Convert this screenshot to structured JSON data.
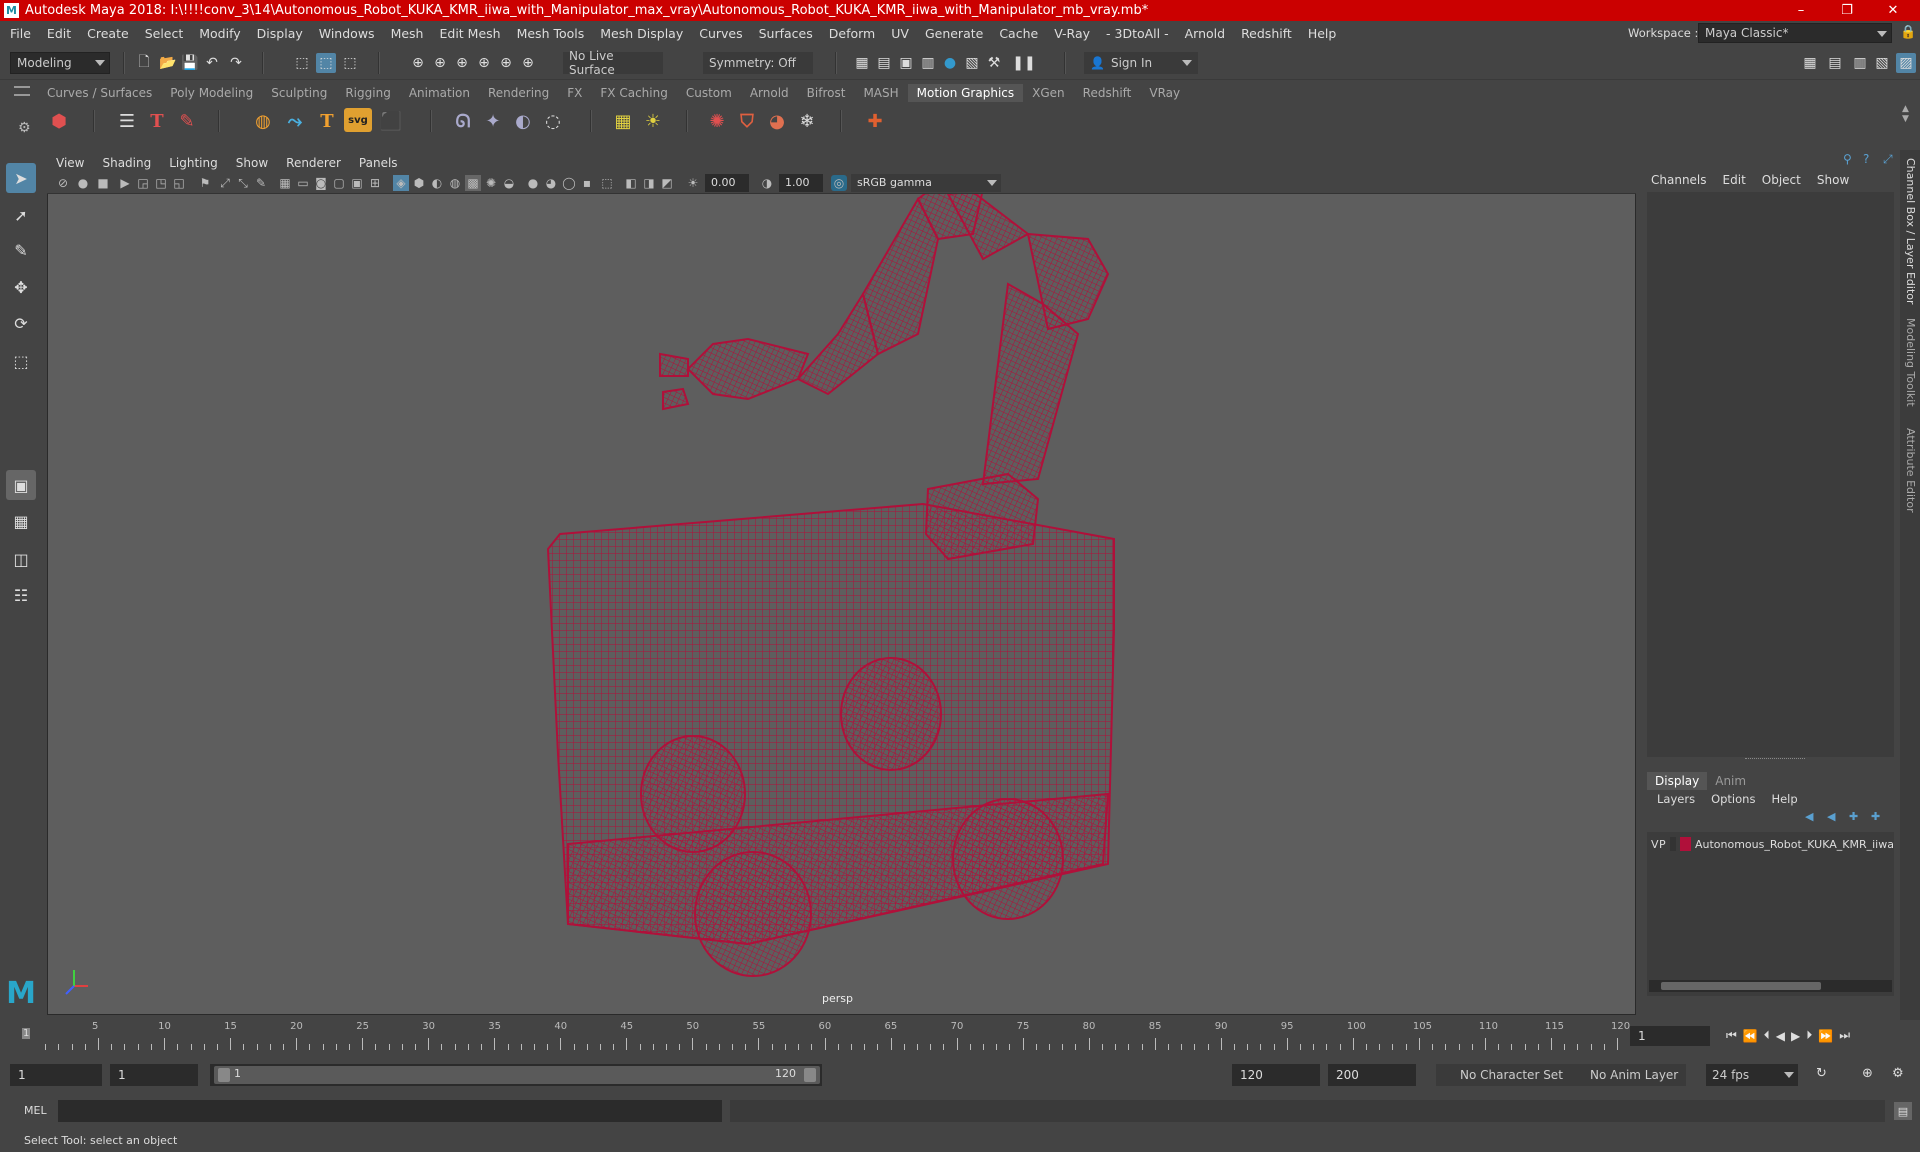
{
  "window": {
    "title": "Autodesk Maya 2018: I:\\!!!!conv_3\\14\\Autonomous_Robot_KUKA_KMR_iiwa_with_Manipulator_max_vray\\Autonomous_Robot_KUKA_KMR_iiwa_with_Manipulator_mb_vray.mb*",
    "logo": "M",
    "minimize": "–",
    "restore": "❐",
    "close": "✕"
  },
  "menubar": {
    "items": [
      "File",
      "Edit",
      "Create",
      "Select",
      "Modify",
      "Display",
      "Windows",
      "Mesh",
      "Edit Mesh",
      "Mesh Tools",
      "Mesh Display",
      "Curves",
      "Surfaces",
      "Deform",
      "UV",
      "Generate",
      "Cache",
      "V-Ray",
      "- 3DtoAll -",
      "Arnold",
      "Redshift",
      "Help"
    ],
    "workspace_label": "Workspace :",
    "workspace_value": "Maya Classic*"
  },
  "toolbar": {
    "mode": "Modeling",
    "live_surface": "No Live Surface",
    "symmetry": "Symmetry: Off",
    "sign_in": "Sign In"
  },
  "shelf": {
    "tabs": [
      "Curves / Surfaces",
      "Poly Modeling",
      "Sculpting",
      "Rigging",
      "Animation",
      "Rendering",
      "FX",
      "FX Caching",
      "Custom",
      "Arnold",
      "Bifrost",
      "MASH",
      "Motion Graphics",
      "XGen",
      "Redshift",
      "VRay"
    ],
    "active_tab": "Motion Graphics",
    "svg_label": "svg"
  },
  "viewport": {
    "menu": [
      "View",
      "Shading",
      "Lighting",
      "Show",
      "Renderer",
      "Panels"
    ],
    "exposure": "0.00",
    "gamma": "1.00",
    "color_space": "sRGB gamma",
    "camera": "persp",
    "wire_color": "#b0103a",
    "bg_color": "#5e5e5e"
  },
  "channel_box": {
    "menu": [
      "Channels",
      "Edit",
      "Object",
      "Show"
    ],
    "side_tabs": [
      "Channel Box / Layer Editor",
      "Modeling Toolkit",
      "Attribute Editor"
    ]
  },
  "layer_editor": {
    "tabs": [
      "Display",
      "Anim"
    ],
    "active_tab": "Display",
    "menu": [
      "Layers",
      "Options",
      "Help"
    ],
    "layers": [
      {
        "v": "V",
        "p": "P",
        "color": "#b0103a",
        "name": "Autonomous_Robot_KUKA_KMR_iiwa"
      }
    ]
  },
  "timeline": {
    "ticks": [
      "5",
      "10",
      "15",
      "20",
      "25",
      "30",
      "35",
      "40",
      "45",
      "50",
      "55",
      "60",
      "65",
      "70",
      "75",
      "80",
      "85",
      "90",
      "95",
      "100",
      "105",
      "110",
      "115",
      "120"
    ],
    "current_frame_marker": "1",
    "current_frame": "1"
  },
  "range": {
    "start": "1",
    "playback_start": "1",
    "slider_start": "1",
    "slider_end": "120",
    "playback_end": "120",
    "end": "200",
    "character_set": "No Character Set",
    "anim_layer": "No Anim Layer",
    "fps": "24 fps"
  },
  "command_line": {
    "label": "MEL"
  },
  "status": {
    "help_line": "Select Tool: select an object"
  }
}
